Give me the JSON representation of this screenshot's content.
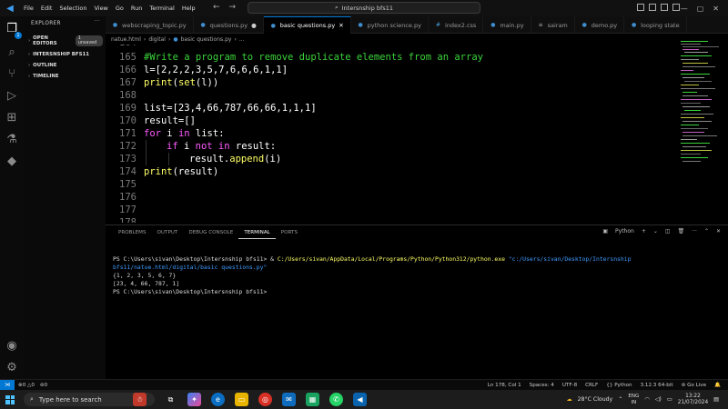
{
  "menu": [
    "File",
    "Edit",
    "Selection",
    "View",
    "Go",
    "Run",
    "Terminal",
    "Help"
  ],
  "command_center": "Intersnship bfs11",
  "sidebar": {
    "title": "EXPLORER",
    "open_editors": "OPEN EDITORS",
    "unsaved": "1 unsaved",
    "workspace": "INTERSNSHIP BFS11",
    "outline": "OUTLINE",
    "timeline": "TIMELINE"
  },
  "tabs": [
    {
      "label": "webscraping_topic.py",
      "icon": "python-file-icon"
    },
    {
      "label": "questions.py",
      "icon": "python-file-icon"
    },
    {
      "label": "basic questions.py",
      "icon": "python-file-icon"
    },
    {
      "label": "python science.py",
      "icon": "python-file-icon"
    },
    {
      "label": "index2.css",
      "icon": "css-file-icon"
    },
    {
      "label": "main.py",
      "icon": "python-file-icon"
    },
    {
      "label": "sairam",
      "icon": "text-file-icon"
    },
    {
      "label": "demo.py",
      "icon": "python-file-icon"
    },
    {
      "label": "looping state",
      "icon": "python-file-icon"
    }
  ],
  "breadcrumb": [
    "natue.html",
    "digital",
    "basic questions.py",
    "..."
  ],
  "editor": {
    "partial_top": "164",
    "lines": [
      {
        "n": "165"
      },
      {
        "n": "166"
      },
      {
        "n": "167"
      },
      {
        "n": "168"
      },
      {
        "n": "169"
      },
      {
        "n": "170"
      },
      {
        "n": "171"
      },
      {
        "n": "172"
      },
      {
        "n": "173"
      },
      {
        "n": "174"
      },
      {
        "n": "175"
      },
      {
        "n": "176"
      },
      {
        "n": "177"
      },
      {
        "n": "178"
      }
    ],
    "code": {
      "l165": "#Write a program to remove duplicate elements from an array",
      "l166": "l=[2,2,2,3,5,7,6,6,6,1,1]",
      "l167_a": "print",
      "l167_b": "(",
      "l167_c": "set",
      "l167_d": "(l))",
      "l169": "list=[23,4,66,787,66,66,1,1,1]",
      "l170": "result=[]",
      "l171_a": "for",
      "l171_b": " i ",
      "l171_c": "in",
      "l171_d": " list:",
      "l172_a": "if",
      "l172_b": " i ",
      "l172_c": "not in",
      "l172_d": " result:",
      "l173_a": "result.",
      "l173_b": "append",
      "l173_c": "(i)",
      "l174_a": "print",
      "l174_b": "(result)"
    }
  },
  "panel": {
    "tabs": [
      "PROBLEMS",
      "OUTPUT",
      "DEBUG CONSOLE",
      "TERMINAL",
      "PORTS"
    ],
    "active": "TERMINAL",
    "shell": "Python",
    "terminal": {
      "prompt1": "PS C:\\Users\\sivan\\Desktop\\Intersnship bfs11> & ",
      "exe": "C:/Users/sivan/AppData/Local/Programs/Python/Python312/python.exe",
      "arg": " \"c:/Users/sivan/Desktop/Intersnship bfs11/natue.html/digital/basic questions.py\"",
      "out1": "{1, 2, 3, 5, 6, 7}",
      "out2": "[23, 4, 66, 787, 1]",
      "prompt2": "PS C:\\Users\\sivan\\Desktop\\Intersnship bfs11>"
    }
  },
  "status": {
    "errors": "0",
    "warnings": "0",
    "ports": "0",
    "position": "Ln 178, Col 1",
    "spaces": "Spaces: 4",
    "encoding": "UTF-8",
    "eol": "CRLF",
    "language": "Python",
    "interpreter": "3.12.3 64-bit",
    "golive": "Go Live"
  },
  "taskbar": {
    "search": "Type here to search",
    "weather": "28°C  Cloudy",
    "lang1": "ENG",
    "lang2": "IN",
    "time": "13:22",
    "date": "21/07/2024"
  }
}
